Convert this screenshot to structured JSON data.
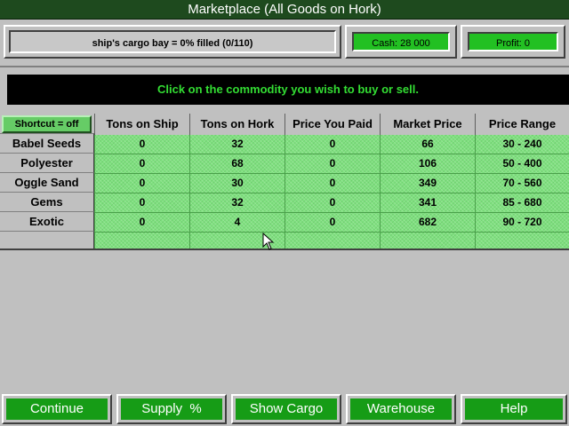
{
  "window": {
    "title": "Marketplace (All Goods on Hork)"
  },
  "status": {
    "cargo_text": "ship's cargo bay = 0% filled (0/110)",
    "cash_text": "Cash: 28 000",
    "profit_text": "Profit: 0"
  },
  "instruction": "Click on the commodity you wish to buy or sell.",
  "table": {
    "shortcut_label": "Shortcut = off",
    "columns": [
      "Tons on Ship",
      "Tons on Hork",
      "Price You Paid",
      "Market Price",
      "Price Range"
    ],
    "rows": [
      {
        "name": "Babel Seeds",
        "cells": [
          "0",
          "32",
          "0",
          "66",
          "30 - 240"
        ]
      },
      {
        "name": "Polyester",
        "cells": [
          "0",
          "68",
          "0",
          "106",
          "50 - 400"
        ]
      },
      {
        "name": "Oggle Sand",
        "cells": [
          "0",
          "30",
          "0",
          "349",
          "70 - 560"
        ]
      },
      {
        "name": "Gems",
        "cells": [
          "0",
          "32",
          "0",
          "341",
          "85 - 680"
        ]
      },
      {
        "name": "Exotic",
        "cells": [
          "0",
          "4",
          "0",
          "682",
          "90 - 720"
        ]
      },
      {
        "name": "",
        "cells": [
          "",
          "",
          "",
          "",
          ""
        ]
      }
    ]
  },
  "buttons": {
    "continue": "Continue",
    "supply": "Supply  %",
    "show_cargo": "Show Cargo",
    "warehouse": "Warehouse",
    "help": "Help"
  },
  "colors": {
    "title_bar": "#1e4a1e",
    "accent_green": "#22c022",
    "grid_green": "#7fe07f",
    "button_green": "#169c16",
    "instruction_text": "#33dd33"
  },
  "icons": {
    "cursor": "arrow-pointer-icon"
  }
}
